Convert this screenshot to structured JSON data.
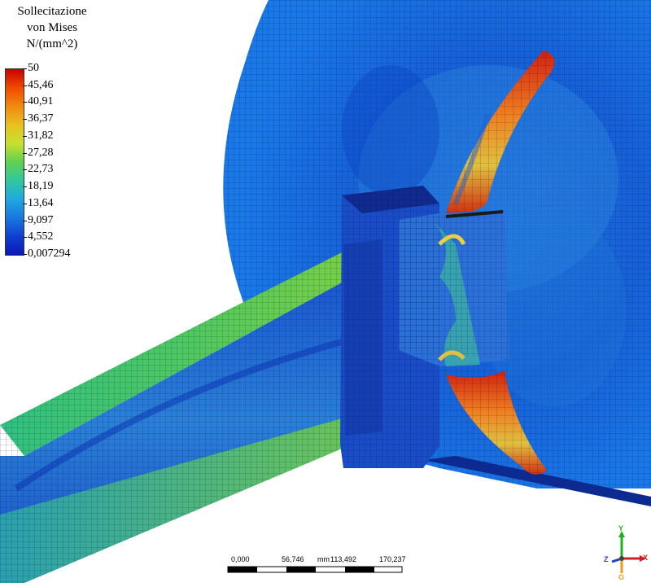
{
  "legend": {
    "title_line1": "Sollecitazione",
    "title_line2": "von Mises",
    "units": "N/(mm^2)",
    "values": [
      "50",
      "45,46",
      "40,91",
      "36,37",
      "31,82",
      "27,28",
      "22,73",
      "18,19",
      "13,64",
      "9,097",
      "4,552",
      "0,007294"
    ]
  },
  "scale_bar": {
    "labels": [
      "0,000",
      "56,746",
      "113,492",
      "170,237"
    ],
    "unit": "mm"
  },
  "triad": {
    "x": "X",
    "y": "Y",
    "z": "Z",
    "g": "G"
  },
  "colors": {
    "max": "#c80000",
    "mid": "#60d050",
    "min": "#0818b8",
    "mesh_background": "#1a5ed8"
  }
}
